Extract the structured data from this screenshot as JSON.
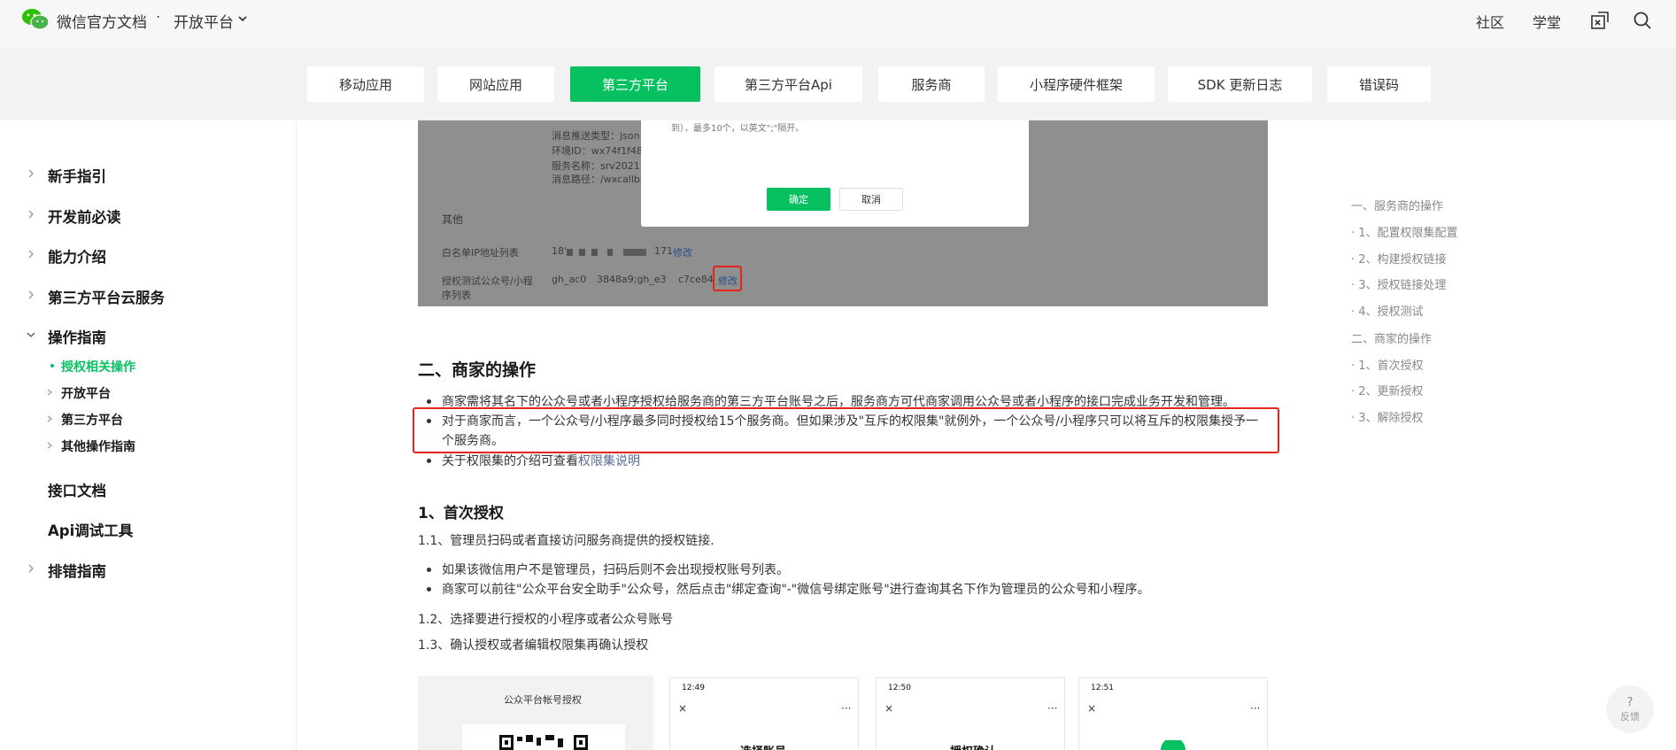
{
  "header": {
    "brand": "微信官方文档",
    "separator": "·",
    "product": "开放平台",
    "links": [
      "社区",
      "学堂"
    ]
  },
  "tabs": [
    {
      "label": "移动应用"
    },
    {
      "label": "网站应用"
    },
    {
      "label": "第三方平台",
      "active": true
    },
    {
      "label": "第三方平台Api"
    },
    {
      "label": "服务商"
    },
    {
      "label": "小程序硬件框架"
    },
    {
      "label": "SDK 更新日志"
    },
    {
      "label": "错误码"
    }
  ],
  "sidebar": {
    "items": [
      {
        "label": "新手指引",
        "chevron": "right"
      },
      {
        "label": "开发前必读",
        "chevron": "right"
      },
      {
        "label": "能力介绍",
        "chevron": "right"
      },
      {
        "label": "第三方平台云服务",
        "chevron": "right"
      },
      {
        "label": "操作指南",
        "chevron": "down"
      },
      {
        "label": "接口文档"
      },
      {
        "label": "Api调试工具"
      },
      {
        "label": "排错指南",
        "chevron": "right"
      }
    ],
    "subitems": [
      {
        "label": "授权相关操作",
        "active": true
      },
      {
        "label": "开放平台"
      },
      {
        "label": "第三方平台"
      },
      {
        "label": "其他操作指南"
      }
    ]
  },
  "embedded_screenshot": {
    "lines": [
      "消息推送类型：json",
      "环境ID：wx74f1f48f8",
      "服务名称：srv202112",
      "消息路径：/wxcallbac"
    ],
    "section_other": "其他",
    "whitelist_label": "白名单IP地址列表",
    "whitelist_value": "18'",
    "whitelist_value_tail": "171",
    "modify": "修改",
    "test_account_label_1": "授权测试公众号/小程",
    "test_account_label_2": "序列表",
    "test_account_value": "gh_ac0",
    "test_account_value_2": "3848a9;gh_e3",
    "test_account_value_3": "c7ce84",
    "dialog_note": "到），最多10个，以英文\";\"隔开。",
    "ok": "确定",
    "cancel": "取消"
  },
  "content": {
    "section_title": "二、商家的操作",
    "bullets": [
      "商家需将其名下的公众号或者小程序授权给服务商的第三方平台账号之后，服务商方可代商家调用公众号或者小程序的接口完成业务开发和管理。",
      "对于商家而言，一个公众号/小程序最多同时授权给15个服务商。但如果涉及\"互斥的权限集\"就例外，一个公众号/小程序只可以将互斥的权限集授予一",
      "个服务商。"
    ],
    "bullet_link_prefix": "关于权限集的介绍可查看",
    "bullet_link": "权限集说明",
    "sub_title": "1、首次授权",
    "step_1_1": "1.1、管理员扫码或者直接访问服务商提供的授权链接.",
    "step_1_1_bullets": [
      "如果该微信用户不是管理员，扫码后则不会出现授权账号列表。",
      "商家可以前往\"公众平台安全助手\"公众号，然后点击\"绑定查询\"-\"微信号绑定账号\"进行查询其名下作为管理员的公众号和小程序。"
    ],
    "step_1_2": "1.2、选择要进行授权的小程序或者公众号账号",
    "step_1_3": "1.3、确认授权或者编辑权限集再确认授权"
  },
  "bottom_shots": {
    "panel_title": "公众平台帐号授权",
    "phones": [
      {
        "time": "12:49",
        "title": "选择账号"
      },
      {
        "time": "12:50",
        "title": "授权确认"
      },
      {
        "time": "12:51",
        "title": ""
      }
    ],
    "close": "×",
    "more": "···"
  },
  "toc": {
    "items": [
      "一、服务商的操作",
      "· 1、配置权限集配置",
      "· 2、构建授权链接",
      "· 3、授权链接处理",
      "· 4、授权测试",
      "二、商家的操作",
      "· 1、首次授权",
      "· 2、更新授权",
      "· 3、解除授权"
    ]
  },
  "feedback": {
    "icon": "?",
    "label": "反馈"
  },
  "colors": {
    "accent": "#07c160",
    "highlight_border": "#e2261c",
    "link": "#576b95"
  }
}
